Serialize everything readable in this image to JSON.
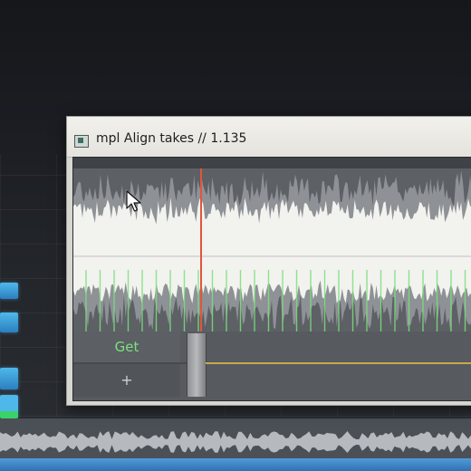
{
  "window": {
    "title": "mpl Align takes // 1.135"
  },
  "controls": {
    "get_label": "Get",
    "add_label": "+"
  },
  "icons": {
    "app": "plugin-window-icon",
    "cursor": "mouse-pointer-icon"
  },
  "colors": {
    "waveform": "#f2f2ee",
    "waveform_shadow": "#8e9196",
    "marker_green": "#7be07d",
    "playhead": "#e2553f",
    "align_line": "#c9a94d",
    "track_clip": "#4fb8ea"
  }
}
